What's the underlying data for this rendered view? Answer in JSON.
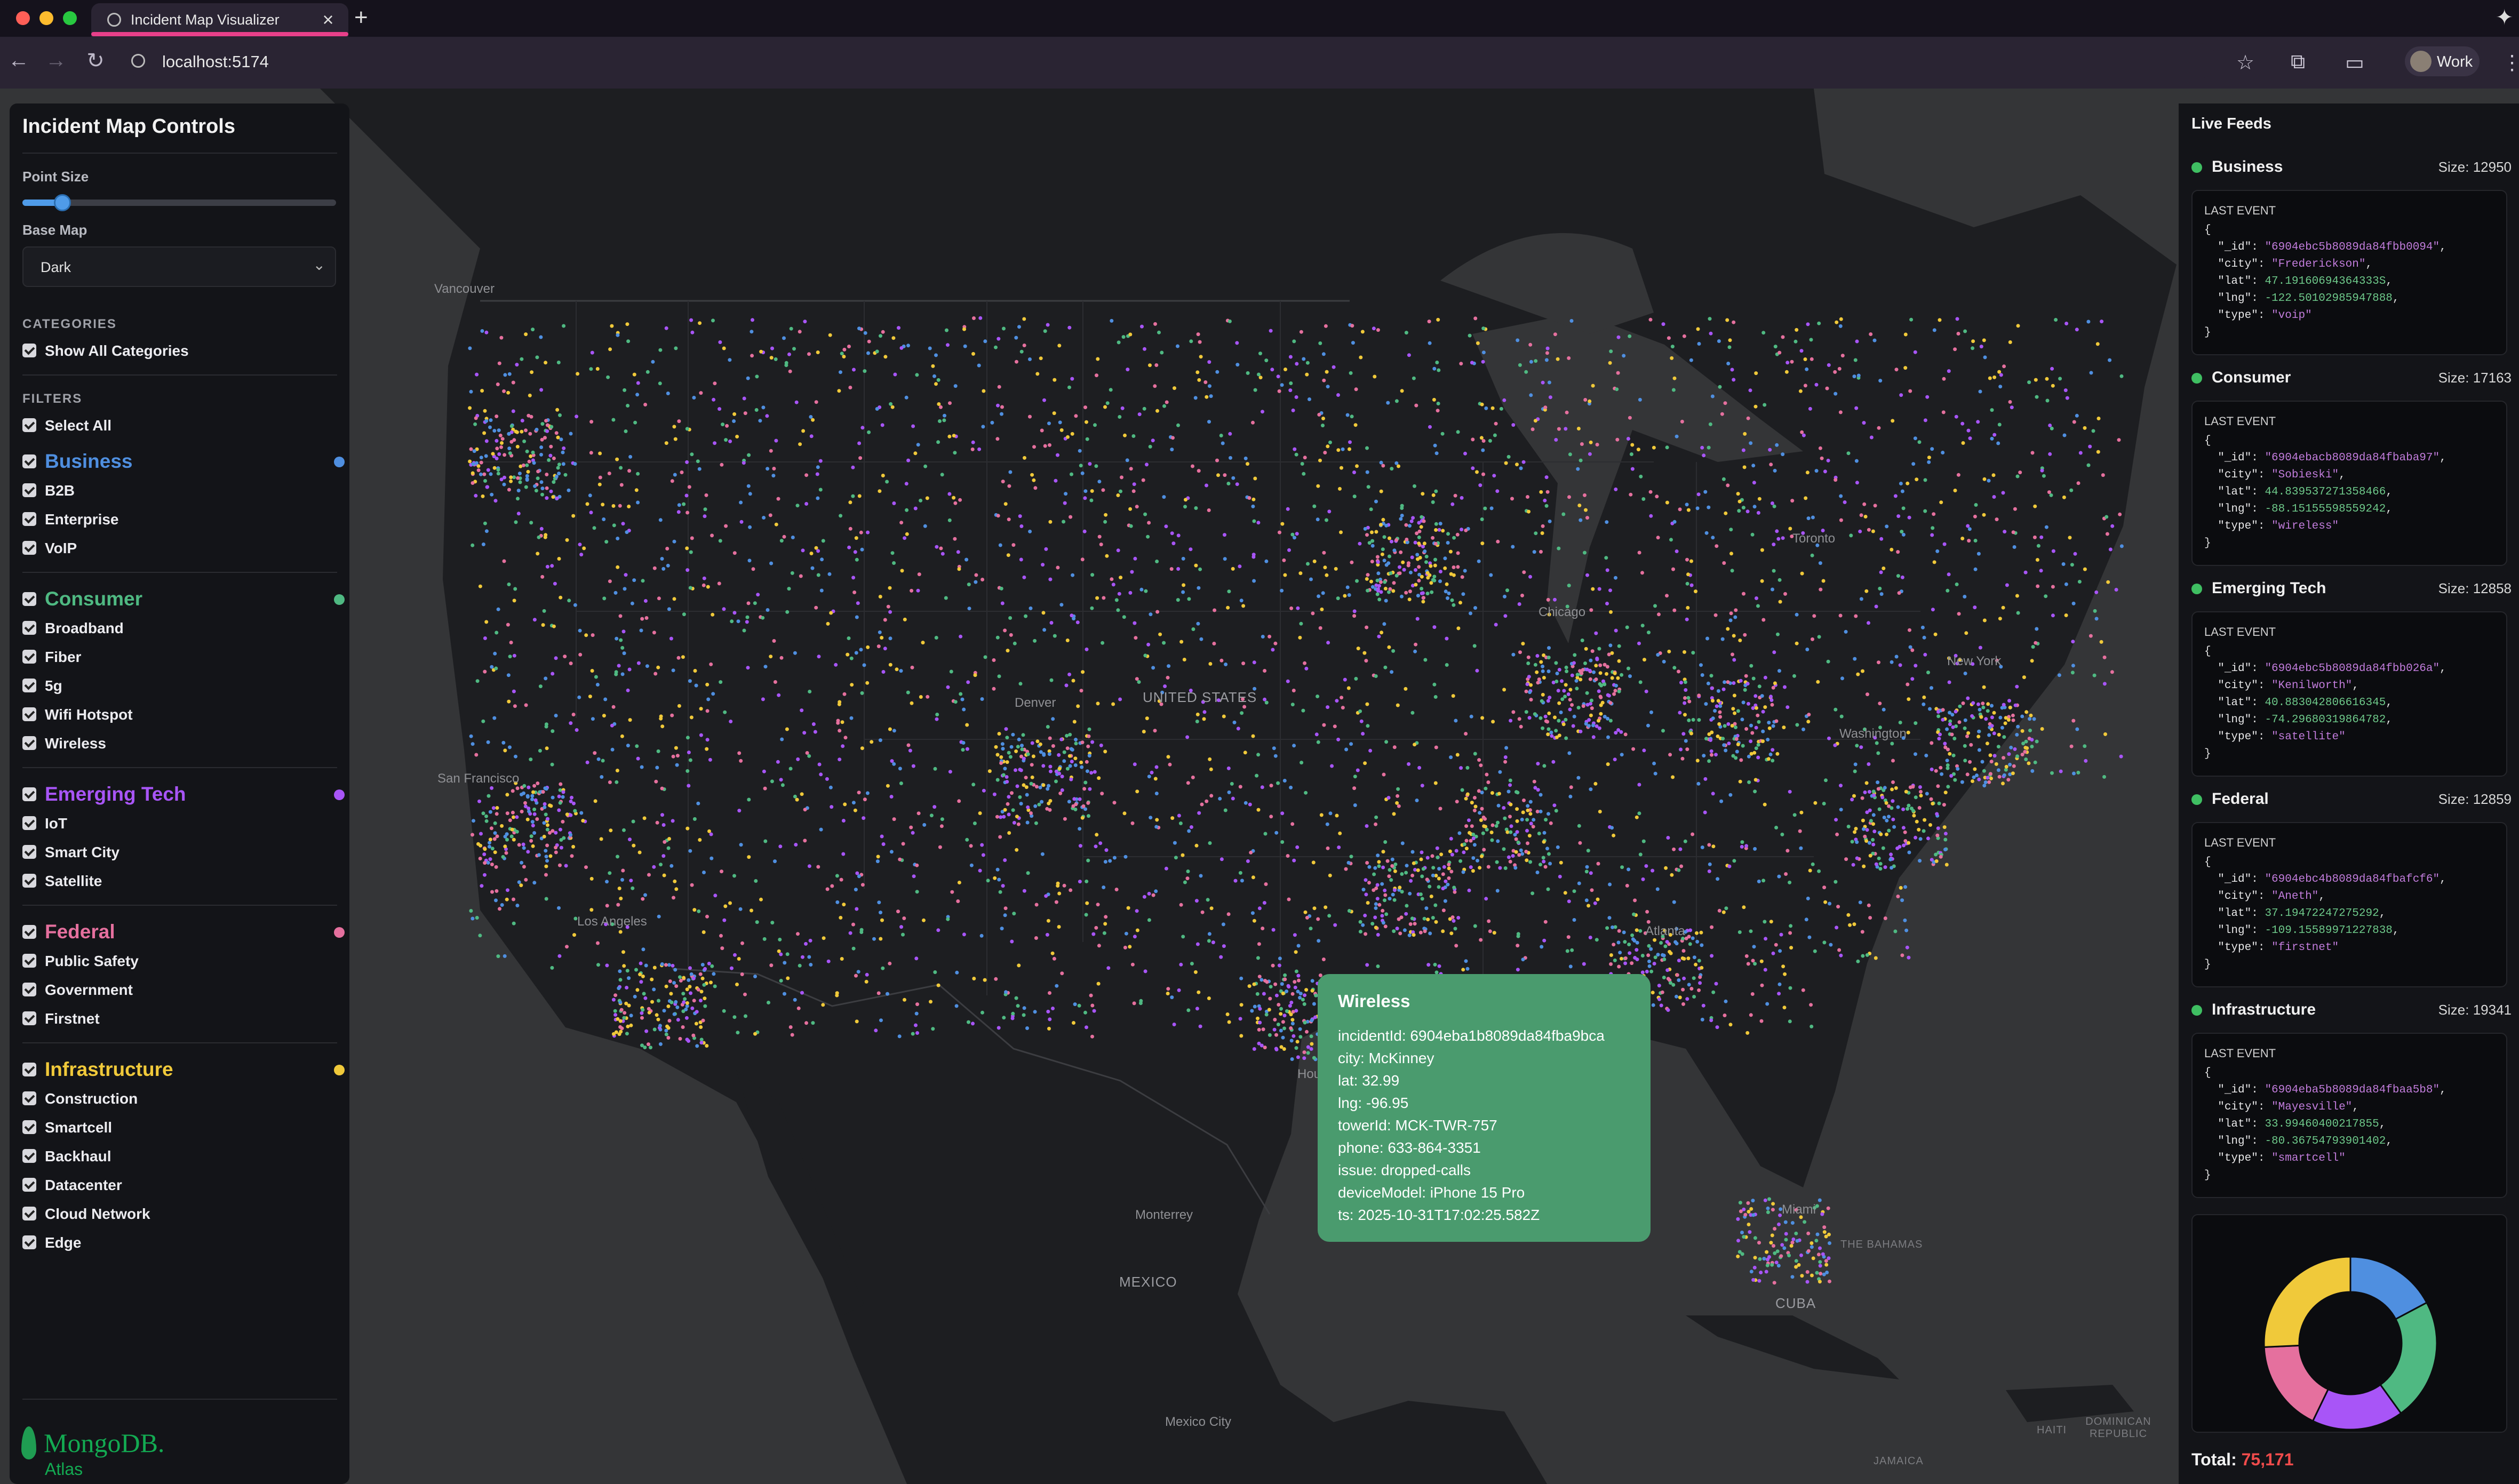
{
  "browser": {
    "tab_title": "Incident Map Visualizer",
    "url": "localhost:5174",
    "profile": "Work",
    "tab_close": "×",
    "new_tab": "+"
  },
  "controls": {
    "title": "Incident Map Controls",
    "point_size_label": "Point Size",
    "point_size_value": 0.1,
    "base_map_label": "Base Map",
    "base_map_value": "Dark",
    "categories_heading": "CATEGORIES",
    "show_all_label": "Show All Categories",
    "filters_heading": "FILTERS",
    "select_all_label": "Select All",
    "groups": [
      {
        "name": "Business",
        "color": "#4f8fe0",
        "items": [
          "B2B",
          "Enterprise",
          "VoIP"
        ]
      },
      {
        "name": "Consumer",
        "color": "#4fb982",
        "items": [
          "Broadband",
          "Fiber",
          "5g",
          "Wifi Hotspot",
          "Wireless"
        ]
      },
      {
        "name": "Emerging Tech",
        "color": "#a855f7",
        "items": [
          "IoT",
          "Smart City",
          "Satellite"
        ]
      },
      {
        "name": "Federal",
        "color": "#e5709e",
        "items": [
          "Public Safety",
          "Government",
          "Firstnet"
        ]
      },
      {
        "name": "Infrastructure",
        "color": "#f0c93a",
        "items": [
          "Construction",
          "Smartcell",
          "Backhaul",
          "Datacenter",
          "Cloud Network",
          "Edge"
        ]
      }
    ]
  },
  "logo": {
    "name": "MongoDB.",
    "sub": "Atlas"
  },
  "feeds": {
    "title": "Live Feeds",
    "last_event_label": "LAST EVENT",
    "items": [
      {
        "name": "Business",
        "size": "Size: 12950",
        "id": "\"6904ebc5b8089da84fbb0094\"",
        "city": "\"Frederickson\"",
        "lat": "47.19160694364333S",
        "lng": "-122.50102985947888",
        "type": "\"voip\""
      },
      {
        "name": "Consumer",
        "size": "Size: 17163",
        "id": "\"6904ebacb8089da84fbaba97\"",
        "city": "\"Sobieski\"",
        "lat": "44.839537271358466",
        "lng": "-88.15155598559242",
        "type": "\"wireless\""
      },
      {
        "name": "Emerging Tech",
        "size": "Size: 12858",
        "id": "\"6904ebc5b8089da84fbb026a\"",
        "city": "\"Kenilworth\"",
        "lat": "40.883042806616345",
        "lng": "-74.29680319864782",
        "type": "\"satellite\""
      },
      {
        "name": "Federal",
        "size": "Size: 12859",
        "id": "\"6904ebc4b8089da84fbafcf6\"",
        "city": "\"Aneth\"",
        "lat": "37.19472247275292",
        "lng": "-109.15589971227838",
        "type": "\"firstnet\""
      },
      {
        "name": "Infrastructure",
        "size": "Size: 19341",
        "id": "\"6904eba5b8089da84fbaa5b8\"",
        "city": "\"Mayesville\"",
        "lat": "33.99460400217855",
        "lng": "-80.36754793901402",
        "type": "\"smartcell\""
      }
    ],
    "total_label": "Total:",
    "total_value": "75,171"
  },
  "donut_chart": {
    "type": "pie",
    "segments": [
      {
        "category": "Business",
        "value": 12950,
        "color": "#4f8fe0"
      },
      {
        "category": "Consumer",
        "value": 17163,
        "color": "#4fb982"
      },
      {
        "category": "Emerging Tech",
        "value": 12858,
        "color": "#a855f7"
      },
      {
        "category": "Federal",
        "value": 12859,
        "color": "#e5709e"
      },
      {
        "category": "Infrastructure",
        "value": 19341,
        "color": "#f0c93a"
      }
    ]
  },
  "tooltip": {
    "title": "Wireless",
    "rows": [
      "incidentId: 6904eba1b8089da84fba9bca",
      "city: McKinney",
      "lat: 32.99",
      "lng: -96.95",
      "towerId: MCK-TWR-757",
      "phone: 633-864-3351",
      "issue: dropped-calls",
      "deviceModel: iPhone 15 Pro",
      "ts: 2025-10-31T17:02:25.582Z"
    ]
  },
  "map_labels": {
    "cities": [
      "Vancouver",
      "San Francisco",
      "Los Angeles",
      "Denver",
      "Chicago",
      "Toronto",
      "Washington",
      "Atlanta",
      "Houston",
      "Miami",
      "Monterrey",
      "Mexico City",
      "New York"
    ],
    "countries": [
      "UNITED STATES",
      "MEXICO",
      "CUBA"
    ],
    "regions": [
      "THE BAHAMAS",
      "HAITI",
      "DOMINICAN REPUBLIC",
      "JAMAICA"
    ]
  },
  "colors": {
    "business": "#4f8fe0",
    "consumer": "#4fb982",
    "emerging_tech": "#a855f7",
    "federal": "#e5709e",
    "infrastructure": "#f0c93a",
    "tooltip_bg": "#4a9b6e",
    "total_value": "#ef4b4b",
    "tab_accent": "#e8408a"
  }
}
